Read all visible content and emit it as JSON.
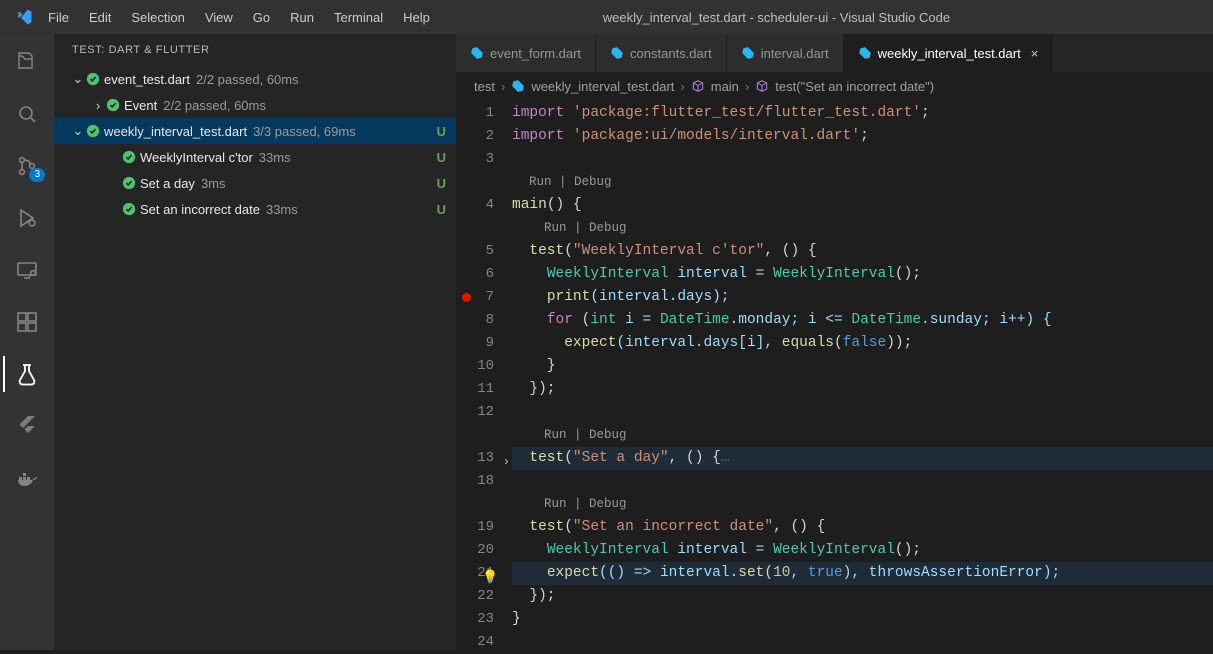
{
  "title": "weekly_interval_test.dart - scheduler-ui - Visual Studio Code",
  "menu": {
    "file": "File",
    "edit": "Edit",
    "selection": "Selection",
    "view": "View",
    "go": "Go",
    "run": "Run",
    "terminal": "Terminal",
    "help": "Help"
  },
  "activity": {
    "scm_badge": "3"
  },
  "sidebar": {
    "title": "TEST: DART & FLUTTER",
    "items": [
      {
        "label": "event_test.dart",
        "meta": "2/2 passed, 60ms",
        "indent": 16,
        "chev": "v",
        "vcs": ""
      },
      {
        "label": "Event",
        "meta": "2/2 passed, 60ms",
        "indent": 36,
        "chev": ">",
        "vcs": ""
      },
      {
        "label": "weekly_interval_test.dart",
        "meta": "3/3 passed, 69ms",
        "indent": 16,
        "chev": "v",
        "vcs": "U",
        "selected": true
      },
      {
        "label": "WeeklyInterval c'tor",
        "meta": "33ms",
        "indent": 52,
        "chev": "",
        "vcs": "U"
      },
      {
        "label": "Set a day",
        "meta": "3ms",
        "indent": 52,
        "chev": "",
        "vcs": "U"
      },
      {
        "label": "Set an incorrect date",
        "meta": "33ms",
        "indent": 52,
        "chev": "",
        "vcs": "U"
      }
    ]
  },
  "tabs": [
    {
      "label": "event_form.dart",
      "active": false
    },
    {
      "label": "constants.dart",
      "active": false
    },
    {
      "label": "interval.dart",
      "active": false
    },
    {
      "label": "weekly_interval_test.dart",
      "active": true
    }
  ],
  "breadcrumbs": {
    "a": "test",
    "b": "weekly_interval_test.dart",
    "c": "main",
    "d": "test(\"Set an incorrect date\")"
  },
  "codelens": {
    "run": "Run",
    "debug": "Debug"
  },
  "lines": [
    {
      "n": "1"
    },
    {
      "n": "2"
    },
    {
      "n": "3"
    },
    {
      "codelens": true
    },
    {
      "n": "4"
    },
    {
      "codelens": true
    },
    {
      "n": "5"
    },
    {
      "n": "6"
    },
    {
      "n": "7",
      "bp": true
    },
    {
      "n": "8"
    },
    {
      "n": "9"
    },
    {
      "n": "10"
    },
    {
      "n": "11"
    },
    {
      "n": "12"
    },
    {
      "codelens": true
    },
    {
      "n": "13",
      "fold": true
    },
    {
      "n": "18"
    },
    {
      "codelens": true
    },
    {
      "n": "19"
    },
    {
      "n": "20"
    },
    {
      "n": "21",
      "bulb": true
    },
    {
      "n": "22"
    },
    {
      "n": "23"
    },
    {
      "n": "24"
    }
  ],
  "code": {
    "l1a": "import",
    "l1b": " 'package:flutter_test/flutter_test.dart'",
    "l1c": ";",
    "l2a": "import",
    "l2b": " 'package:ui/models/interval.dart'",
    "l2c": ";",
    "l4": "main",
    "l4b": "() {",
    "l5a": "  ",
    "l5b": "test",
    "l5c": "(",
    "l5d": "\"WeeklyInterval c'tor\"",
    "l5e": ", () {",
    "l6a": "    ",
    "l6b": "WeeklyInterval",
    "l6c": " interval = ",
    "l6d": "WeeklyInterval",
    "l6e": "();",
    "l7a": "    ",
    "l7b": "print",
    "l7c": "(interval.days);",
    "l8a": "    ",
    "l8b": "for",
    "l8c": " (",
    "l8d": "int",
    "l8e": " i = ",
    "l8f": "DateTime",
    "l8g": ".monday; i <= ",
    "l8h": "DateTime",
    "l8i": ".sunday; i++) {",
    "l9a": "      ",
    "l9b": "expect",
    "l9c": "(interval.days[i], ",
    "l9d": "equals",
    "l9e": "(",
    "l9f": "false",
    "l9g": "));",
    "l10": "    }",
    "l11": "  });",
    "l13a": "  ",
    "l13b": "test",
    "l13c": "(",
    "l13d": "\"Set a day\"",
    "l13e": ", () {",
    "l13f": "…",
    "l19a": "  ",
    "l19b": "test",
    "l19c": "(",
    "l19d": "\"Set an incorrect date\"",
    "l19e": ", () {",
    "l20a": "    ",
    "l20b": "WeeklyInterval",
    "l20c": " interval = ",
    "l20d": "WeeklyInterval",
    "l20e": "();",
    "l21a": "    ",
    "l21b": "expect",
    "l21c": "(() => interval.",
    "l21d": "set",
    "l21e": "(",
    "l21f": "10",
    "l21g": ", ",
    "l21h": "true",
    "l21i": "), throwsAssertionError);",
    "l22": "  });",
    "l23": "}"
  }
}
